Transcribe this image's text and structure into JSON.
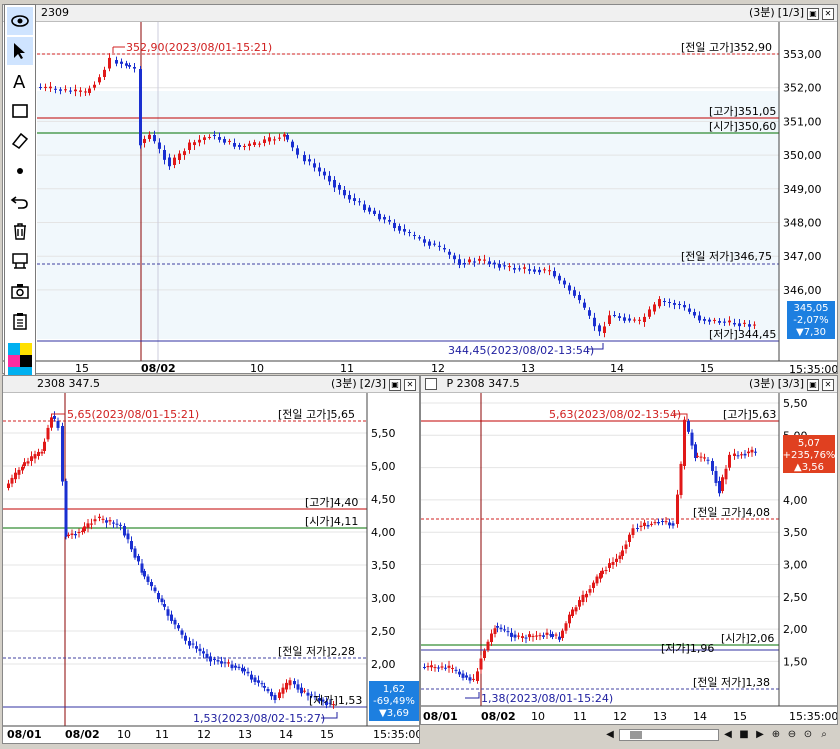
{
  "top": {
    "title_suffix": "2309",
    "interval": "(3분)",
    "pane_idx": "[1/3]",
    "label_prev_high": "[전일 고가]352,90",
    "label_high": "[고가]351,05",
    "label_open": "[시가]350,60",
    "label_prev_low": "[전일 저가]346,75",
    "label_low": "[저가]344,45",
    "annot_high": "352,90(2023/08/01-15:21)",
    "annot_low": "344,45(2023/08/02-13:54)",
    "badge": [
      "345,05",
      "-2,07%",
      "▼7,30"
    ],
    "yticks": [
      "353,00",
      "352,00",
      "351,00",
      "350,00",
      "349,00",
      "348,00",
      "347,00",
      "346,00"
    ],
    "xticks": [
      "15",
      "08/02",
      "10",
      "11",
      "12",
      "13",
      "14",
      "15"
    ],
    "time": "15:35:00"
  },
  "bl": {
    "title": "2308 347.5",
    "interval": "(3분)",
    "pane_idx": "[2/3]",
    "label_prev_high": "[전일 고가]5,65",
    "label_high": "[고가]4,40",
    "label_open": "[시가]4,11",
    "label_prev_low": "[전일 저가]2,28",
    "label_low": "[저가]1,53",
    "annot_high": "5,65(2023/08/01-15:21)",
    "annot_low": "1,53(2023/08/02-15:27)",
    "badge": [
      "1,62",
      "-69,49%",
      "▼3,69"
    ],
    "yticks": [
      "5,50",
      "5,00",
      "4,50",
      "4,00",
      "3,50",
      "3,00",
      "2,50",
      "2,00"
    ],
    "xticks": [
      "08/01",
      "08/02",
      "10",
      "11",
      "12",
      "13",
      "14",
      "15"
    ],
    "time": "15:35:00"
  },
  "br": {
    "title": "P 2308 347.5",
    "interval": "(3분)",
    "pane_idx": "[3/3]",
    "label_high": "[고가]5,63",
    "label_prev_high": "[전일 고가]4,08",
    "label_open": "[시가]2,06",
    "label_low": "[저가]1,96",
    "label_prev_low": "[전일 저가]1,38",
    "annot_high": "5,63(2023/08/02-13:54)",
    "annot_low": "1,38(2023/08/01-15:24)",
    "badge": [
      "5,07",
      "+235,76%",
      "▲3,56"
    ],
    "yticks": [
      "5,50",
      "5,00",
      "4,50",
      "4,00",
      "3,50",
      "3,00",
      "2,50",
      "2,00",
      "1,50"
    ],
    "xticks": [
      "08/01",
      "08/02",
      "10",
      "11",
      "12",
      "13",
      "14",
      "15"
    ],
    "time": "15:35:00"
  },
  "tools": [
    "eye-icon",
    "pointer-icon",
    "text-icon",
    "rectangle-icon",
    "eraser-icon",
    "dot-icon",
    "undo-icon",
    "trash-icon",
    "magnet-icon",
    "camera-icon",
    "clipboard-icon"
  ],
  "colors": {
    "up": "#e01818",
    "down": "#1a2fd0",
    "badge_blue": "#1d7fe0",
    "badge_red": "#e04020"
  }
}
